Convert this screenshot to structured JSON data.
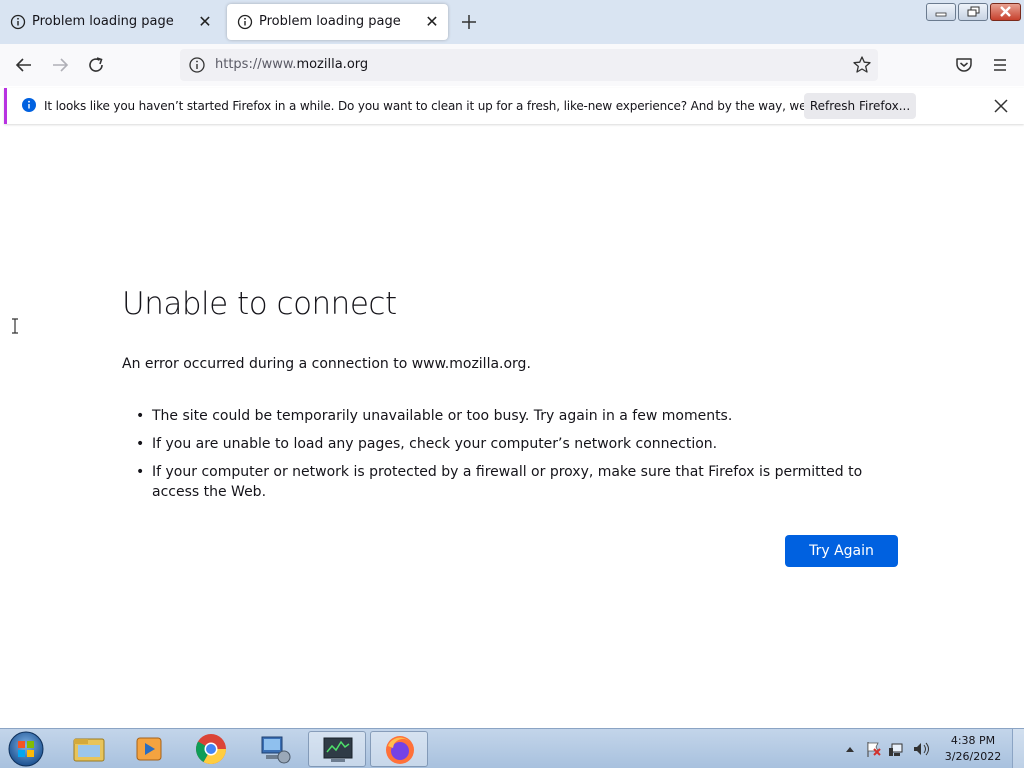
{
  "tabs": [
    {
      "title": "Problem loading page",
      "icon": "info-circle-icon",
      "close_icon": "close-icon",
      "active": false
    },
    {
      "title": "Problem loading page",
      "icon": "info-circle-icon",
      "close_icon": "close-icon",
      "active": true
    }
  ],
  "navbar": {
    "url_prefix": "https://www.",
    "url_domain": "mozilla.org",
    "icons": [
      "back-arrow-icon",
      "forward-arrow-icon",
      "reload-icon",
      "info-circle-icon",
      "star-icon",
      "pocket-icon",
      "hamburger-menu-icon"
    ]
  },
  "notification": {
    "message": "It looks like you haven’t started Firefox in a while. Do you want to clean it up for a fresh, like-new experience? And by the way, welcome back!",
    "button_label": "Refresh Firefox...",
    "accent_color": "#b833e1",
    "icon_color": "#0061e0"
  },
  "error_page": {
    "title": "Unable to connect",
    "description": "An error occurred during a connection to www.mozilla.org.",
    "items": [
      "The site could be temporarily unavailable or too busy. Try again in a few moments.",
      "If you are unable to load any pages, check your computer’s network connection.",
      "If your computer or network is protected by a firewall or proxy, make sure that Firefox is permitted to access the Web."
    ],
    "button_label": "Try Again",
    "button_color": "#0061e0"
  },
  "taskbar": {
    "pinned": [
      "file-explorer-icon",
      "media-player-icon",
      "chrome-icon",
      "network-computer-icon",
      "task-manager-icon",
      "firefox-icon"
    ],
    "tray_icons": [
      "show-hidden-icons-chevron",
      "action-center-flag-icon",
      "network-icon",
      "volume-icon"
    ],
    "time": "4:38 PM",
    "date": "3/26/2022"
  }
}
